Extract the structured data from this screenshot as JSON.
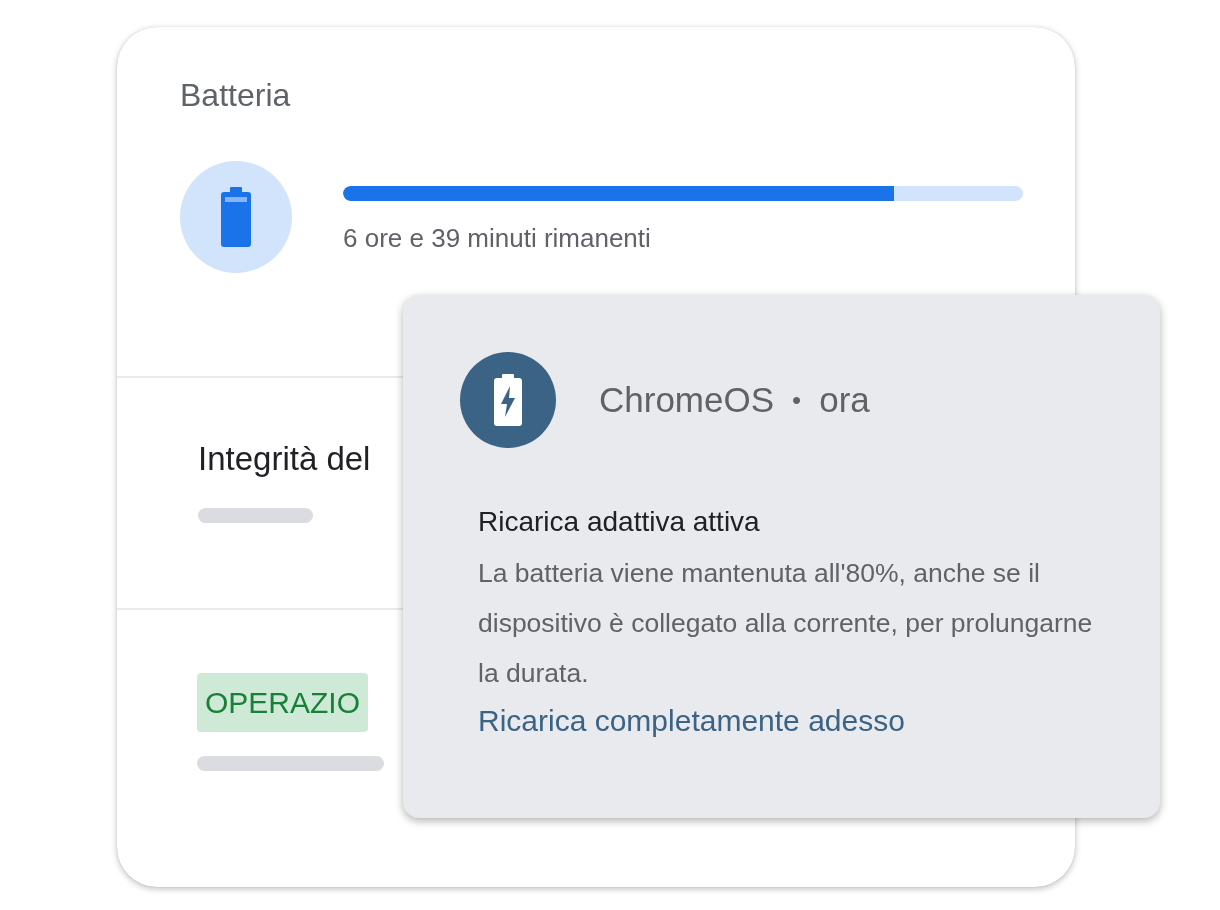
{
  "card": {
    "title": "Batteria",
    "battery": {
      "level": 0.81,
      "remaining": "6 ore e 39 minuti rimanenti"
    },
    "health": {
      "label": "Integrità del"
    },
    "status": {
      "badge": "OPERAZIO"
    }
  },
  "notification": {
    "app": "ChromeOS",
    "separator": "•",
    "time": "ora",
    "title": "Ricarica adattiva attiva",
    "body": "La batteria viene mantenuta all'80%, anche se il dispositivo è collegato alla corrente, per prolungarne la durata.",
    "link": "Ricarica completamente adesso"
  }
}
